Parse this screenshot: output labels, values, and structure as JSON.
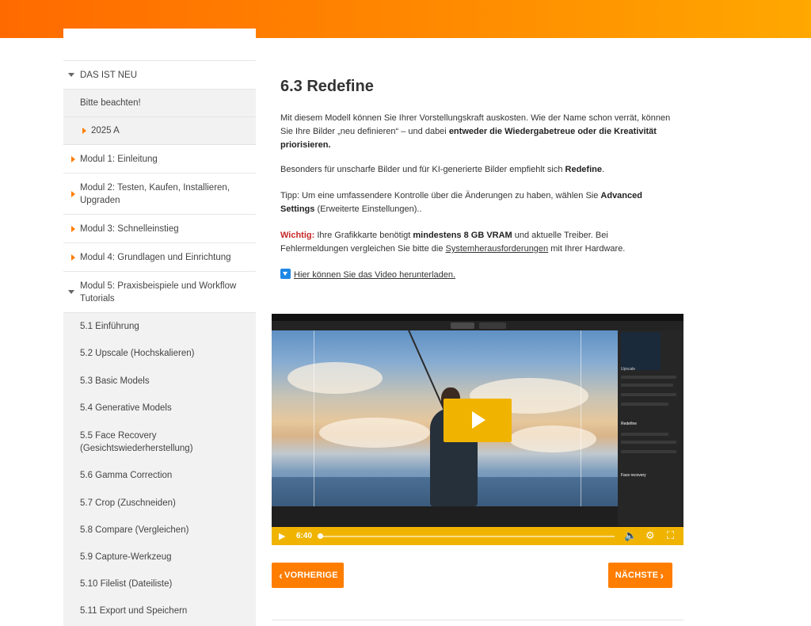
{
  "sidebar": {
    "items": [
      {
        "label": "DAS IST NEU"
      },
      {
        "label": "Bitte beachten!"
      },
      {
        "label": "2025 A"
      },
      {
        "label": "Modul 1: Einleitung"
      },
      {
        "label": "Modul 2: Testen, Kaufen, Installieren, Upgraden"
      },
      {
        "label": "Modul 3: Schnelleinstieg"
      },
      {
        "label": "Modul 4: Grundlagen und Einrichtung"
      },
      {
        "label": "Modul 5: Praxisbeispiele und Workflow Tutorials"
      },
      {
        "label": "5.1 Einführung"
      },
      {
        "label": "5.2 Upscale (Hochskalieren)"
      },
      {
        "label": "5.3 Basic Models"
      },
      {
        "label": "5.4 Generative Models"
      },
      {
        "label": "5.5 Face Recovery (Gesichtswiederherstellung)"
      },
      {
        "label": "5.6 Gamma Correction"
      },
      {
        "label": "5.7 Crop (Zuschneiden)"
      },
      {
        "label": "5.8 Compare (Vergleichen)"
      },
      {
        "label": "5.9 Capture-Werkzeug"
      },
      {
        "label": "5.10 Filelist (Dateiliste)"
      },
      {
        "label": "5.11 Export und Speichern"
      }
    ]
  },
  "main": {
    "title": "6.3 Redefine",
    "p1": {
      "a": "Mit diesem Modell können Sie Ihrer Vorstellungskraft auskosten. Wie der Name schon verrät, können Sie Ihre Bilder „neu definieren“ – und dabei ",
      "b": "entweder die Wiedergabetreue oder die Kreativität priorisieren."
    },
    "p2": {
      "a": "Besonders für unscharfe Bilder und für KI-generierte Bilder empfiehlt sich ",
      "b": "Redefine",
      "c": "."
    },
    "p3": {
      "a": "Tipp: Um eine umfassendere Kontrolle über die Änderungen zu haben, wählen Sie ",
      "b": "Advanced Settings",
      "c": " (Erweiterte Einstellungen).."
    },
    "p4": {
      "warn": "Wichtig:",
      "a": " Ihre Grafikkarte benötigt ",
      "b": "mindestens 8 GB VRAM",
      "c": " und aktuelle Treiber. Bei Fehlermeldungen vergleichen Sie bitte die ",
      "link": "Systemherausforderungen",
      "d": " mit Ihrer Hardware."
    },
    "download_link": "Hier können Sie das Video herunterladen."
  },
  "video": {
    "time": "6:40",
    "panel": {
      "upscale": "Upscale",
      "redefine": "Redefine",
      "face_recovery": "Face recovery"
    },
    "progress": 0.0
  },
  "nav": {
    "prev_label": "VORHERIGE",
    "next_label": "NÄCHSTE"
  },
  "colors": {
    "accent": "#ff7d00",
    "video_bar": "#f0b400",
    "warn": "#c62828",
    "link_icon": "#1e88e5"
  }
}
